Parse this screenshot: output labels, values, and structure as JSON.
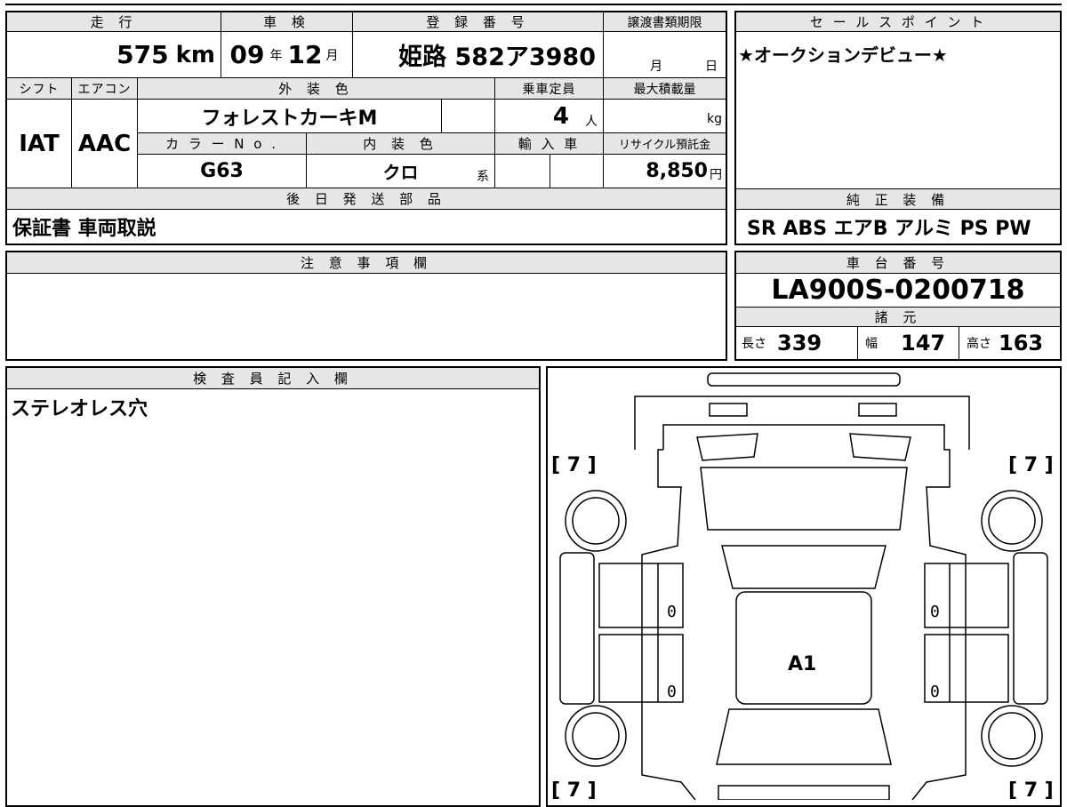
{
  "top_sheet": {
    "mileage": {
      "label": "走 行",
      "value": "575",
      "unit": "km"
    },
    "inspection": {
      "label": "車 検",
      "year": "09",
      "year_unit": "年",
      "month": "12",
      "month_unit": "月"
    },
    "registration": {
      "label": "登 録 番 号",
      "value": "姫路 582ア3980"
    },
    "transfer_deadline": {
      "label": "譲渡書類期限",
      "month_unit": "月",
      "day_unit": "日"
    },
    "shift": {
      "label": "シフト",
      "value": "IAT"
    },
    "aircon": {
      "label": "エアコン",
      "value": "AAC"
    },
    "exterior_color": {
      "label": "外 装 色",
      "value": "フォレストカーキM"
    },
    "capacity": {
      "label": "乗車定員",
      "value": "4",
      "unit": "人"
    },
    "max_load": {
      "label": "最大積載量",
      "unit": "kg"
    },
    "color_no": {
      "label": "カ ラ ー N o .",
      "value": "G63"
    },
    "interior_color": {
      "label": "内 装 色",
      "value": "クロ",
      "suffix": "系"
    },
    "import": {
      "label": "輸 入 車"
    },
    "recycle": {
      "label": "リサイクル預託金",
      "value": "8,850",
      "unit": "円"
    }
  },
  "sales_point": {
    "label": "セ ー ル ス ポ イ ン ト",
    "text": "★オークションデビュー★"
  },
  "later_shipping": {
    "label": "後 日 発 送 部 品",
    "text": "保証書 車両取説"
  },
  "genuine_equipment": {
    "label": "純 正 装 備",
    "text": "SR ABS エアB アルミ PS PW"
  },
  "notes": {
    "label": "注 意 事 項 欄",
    "text": ""
  },
  "chassis": {
    "label": "車 台 番 号",
    "value": "LA900S-0200718"
  },
  "specs": {
    "label": "諸 元",
    "length_label": "長さ",
    "length": "339",
    "width_label": "幅",
    "width": "147",
    "height_label": "高さ",
    "height": "163"
  },
  "inspector": {
    "label": "検 査 員 記 入 欄",
    "text": "ステレオレス穴"
  },
  "diagram": {
    "tire_fl": "[ 7 ]",
    "tire_fr": "[ 7 ]",
    "tire_rl": "[ 7 ]",
    "tire_rr": "[ 7 ]",
    "left_door_front": "0",
    "left_door_rear": "0",
    "right_door_front": "0",
    "right_door_rear": "0",
    "roof_grade": "A1"
  }
}
